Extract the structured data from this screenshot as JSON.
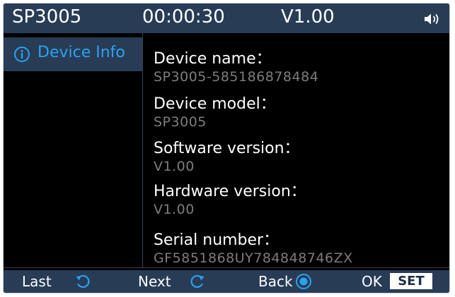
{
  "status_bar": {
    "model": "SP3005",
    "timer": "00:00:30",
    "version": "V1.00",
    "volume_icon": "speaker-icon"
  },
  "sidebar": {
    "items": [
      {
        "label": "Device Info",
        "icon": "info-icon",
        "selected": true
      }
    ]
  },
  "device_info": {
    "device_name_label": "Device name：",
    "device_name_value": "SP3005-585186878484",
    "device_model_label": "Device model：",
    "device_model_value": "SP3005",
    "software_version_label": "Software version：",
    "software_version_value": "V1.00",
    "hardware_version_label": "Hardware version：",
    "hardware_version_value": "V1.00",
    "serial_number_label": "Serial number：",
    "serial_number_value": "GF5851868UY784848746ZX"
  },
  "bottom_bar": {
    "last_label": "Last",
    "next_label": "Next",
    "back_label": "Back",
    "ok_label": "OK",
    "set_label": "SET"
  },
  "colors": {
    "bar_background": "#283c56",
    "accent": "#2aa3f0",
    "value_text": "#7d7d7d",
    "background": "#000000"
  }
}
